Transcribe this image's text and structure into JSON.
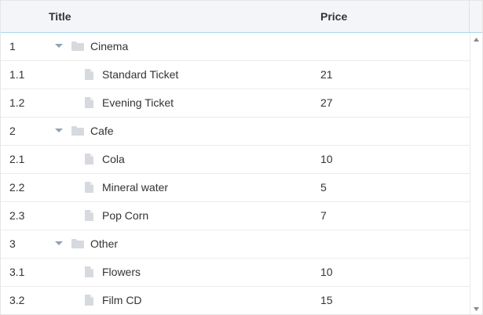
{
  "header": {
    "title": "Title",
    "price": "Price"
  },
  "rows": [
    {
      "num": "1",
      "title": "Cinema",
      "price": "",
      "kind": "folder"
    },
    {
      "num": "1.1",
      "title": "Standard Ticket",
      "price": "21",
      "kind": "file"
    },
    {
      "num": "1.2",
      "title": "Evening Ticket",
      "price": "27",
      "kind": "file"
    },
    {
      "num": "2",
      "title": "Cafe",
      "price": "",
      "kind": "folder"
    },
    {
      "num": "2.1",
      "title": "Cola",
      "price": "10",
      "kind": "file"
    },
    {
      "num": "2.2",
      "title": "Mineral water",
      "price": "5",
      "kind": "file"
    },
    {
      "num": "2.3",
      "title": "Pop Corn",
      "price": "7",
      "kind": "file"
    },
    {
      "num": "3",
      "title": "Other",
      "price": "",
      "kind": "folder"
    },
    {
      "num": "3.1",
      "title": "Flowers",
      "price": "10",
      "kind": "file"
    },
    {
      "num": "3.2",
      "title": "Film CD",
      "price": "15",
      "kind": "file"
    }
  ],
  "icons": {
    "expand": "chevron-down-icon",
    "folder": "folder-icon",
    "file": "file-icon",
    "scroll_up": "scroll-up-icon",
    "scroll_down": "scroll-down-icon"
  },
  "colors": {
    "header_bg": "#f4f5f9",
    "header_border": "#a8d5ee",
    "row_border": "#ebebeb",
    "icon_gray": "#d6d9de",
    "chevron": "#94a1b3",
    "text": "#333333"
  }
}
